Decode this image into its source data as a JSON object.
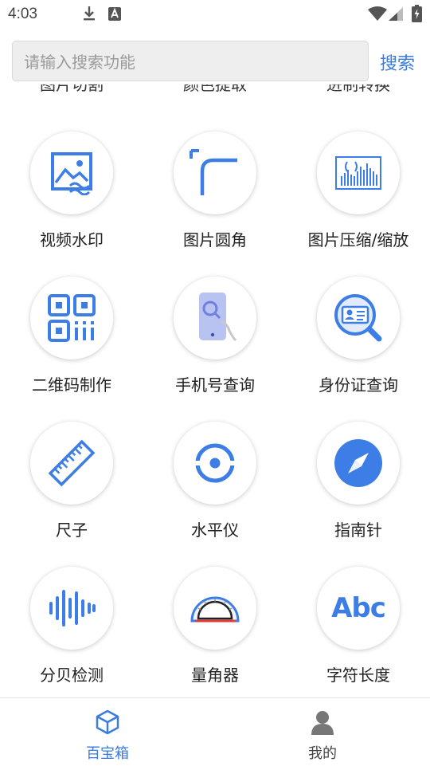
{
  "status_bar": {
    "time": "4:03"
  },
  "search": {
    "placeholder": "请输入搜索功能",
    "value": "",
    "button_label": "搜索"
  },
  "partial_row": [
    "图片切割",
    "颜色提取",
    "进制转换"
  ],
  "tools": [
    {
      "label": "视频水印",
      "icon": "video-watermark-icon"
    },
    {
      "label": "图片圆角",
      "icon": "rounded-corner-icon"
    },
    {
      "label": "图片压缩/缩放",
      "icon": "image-compress-icon"
    },
    {
      "label": "二维码制作",
      "icon": "qr-code-icon"
    },
    {
      "label": "手机号查询",
      "icon": "phone-search-icon"
    },
    {
      "label": "身份证查询",
      "icon": "id-card-search-icon"
    },
    {
      "label": "尺子",
      "icon": "ruler-icon"
    },
    {
      "label": "水平仪",
      "icon": "level-icon"
    },
    {
      "label": "指南针",
      "icon": "compass-icon"
    },
    {
      "label": "分贝检测",
      "icon": "sound-wave-icon"
    },
    {
      "label": "量角器",
      "icon": "protractor-icon"
    },
    {
      "label": "字符长度",
      "icon": "text-length-icon",
      "glyph": "Abc"
    }
  ],
  "bottom_nav": [
    {
      "label": "百宝箱",
      "icon": "box-icon",
      "active": true
    },
    {
      "label": "我的",
      "icon": "person-icon",
      "active": false
    }
  ],
  "colors": {
    "accent": "#3a7be0",
    "inactive": "#444444",
    "icon_blue": "#3d7ee6"
  }
}
